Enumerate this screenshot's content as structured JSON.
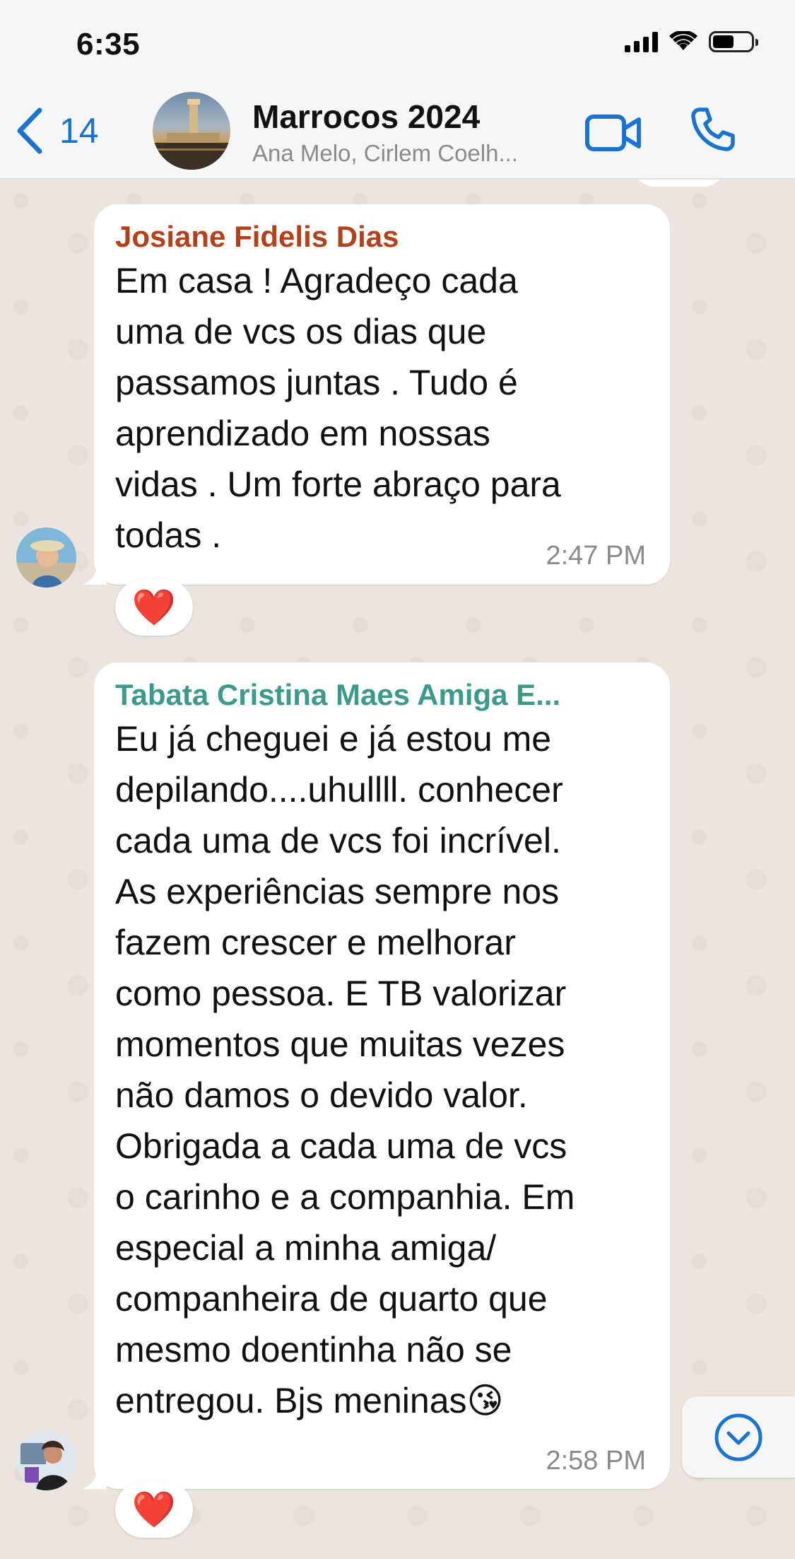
{
  "status_bar": {
    "time": "6:35"
  },
  "header": {
    "back_count": "14",
    "title": "Marrocos 2024",
    "subtitle": "Ana Melo, Cirlem Coelh..."
  },
  "colors": {
    "accent": "#1a73d0",
    "sender1": "#b3411b",
    "sender2": "#3d9a8b",
    "chat_bg": "#ece5dd"
  },
  "messages": [
    {
      "sender": "Josiane Fidelis Dias",
      "text": "Em casa ! Agradeço cada\numa de vcs os dias que\npassamos juntas . Tudo é\naprendizado em nossas\nvidas . Um forte abraço para\ntodas .",
      "time": "2:47 PM",
      "reaction": "❤️"
    },
    {
      "sender": "Tabata Cristina Maes Amiga E...",
      "text": "Eu já cheguei e já estou me\ndepilando....uhullll. conhecer\ncada uma de vcs foi incrível.\nAs experiências sempre nos\nfazem crescer e melhorar\ncomo pessoa. E TB valorizar\nmomentos que muitas vezes\nnão damos o devido valor.\nObrigada a cada uma de vcs\no carinho e a companhia. Em\nespecial a minha amiga/\ncompanheira de quarto que\nmesmo doentinha não se\nentregou. Bjs meninas😘",
      "time": "2:58 PM",
      "reaction": "❤️"
    }
  ]
}
